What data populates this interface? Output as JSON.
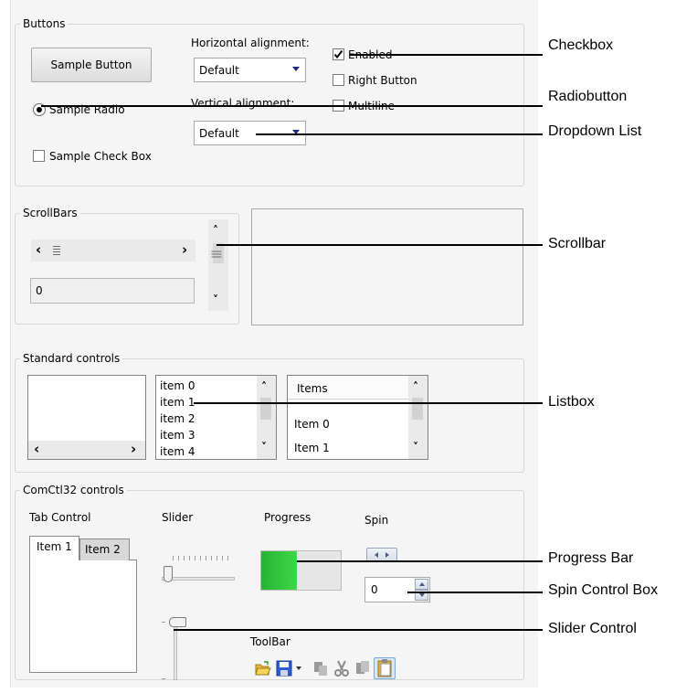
{
  "groups": {
    "buttons": "Buttons",
    "scrollbars": "ScrollBars",
    "standard": "Standard controls",
    "comctl": "ComCtl32 controls"
  },
  "buttons_group": {
    "sample_button": "Sample Button",
    "sample_radio": "Sample Radio",
    "sample_checkbox": "Sample Check Box",
    "h_align_label": "Horizontal alignment:",
    "h_align_value": "Default",
    "v_align_label": "Vertical alignment:",
    "v_align_value": "Default",
    "enabled": "Enabled",
    "right_button": "Right Button",
    "multiline": "Multiline",
    "enabled_checked": true,
    "radio_selected": true
  },
  "scrollbars_group": {
    "value": "0",
    "h_left_glyph": "‹",
    "h_right_glyph": "›"
  },
  "standard_group": {
    "listbox_items": [
      "item 0",
      "item 1",
      "item 2",
      "item 3",
      "item 4"
    ],
    "listview_header": "Items",
    "listview_items": [
      "Item 0",
      "Item 1"
    ]
  },
  "comctl_group": {
    "tab_control_label": "Tab Control",
    "tabs": [
      "Item 1",
      "Item 2"
    ],
    "slider_label": "Slider",
    "progress_label": "Progress",
    "progress_fraction": 0.45,
    "spin_label": "Spin",
    "spin_value": "0",
    "toolbar_label": "ToolBar",
    "toolbar_icons": [
      "open-folder-icon",
      "save-icon",
      "dropdown-arrow-icon",
      "copy-icon",
      "cut-icon",
      "copy-pages-icon",
      "paste-icon"
    ]
  },
  "callouts": {
    "checkbox": "Checkbox",
    "radiobutton": "Radiobutton",
    "dropdown": "Dropdown List",
    "scrollbar": "Scrollbar",
    "listbox": "Listbox",
    "progress": "Progress Bar",
    "spin": "Spin Control Box",
    "slider": "Slider Control"
  },
  "colors": {
    "panel_bg": "#f5f5f5",
    "progress_green": "#2fc43a",
    "dropdown_arrow": "#1b2a8c"
  }
}
